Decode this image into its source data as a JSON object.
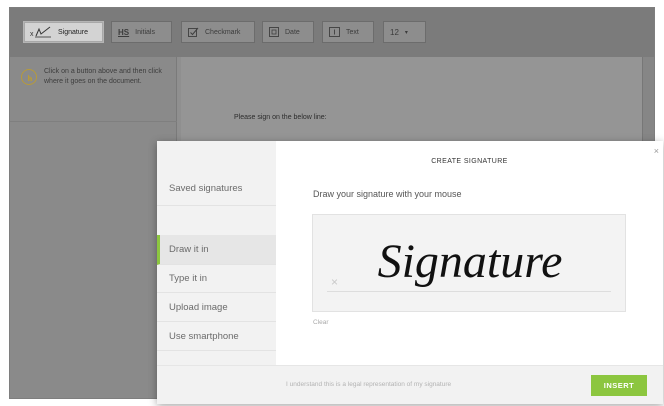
{
  "toolbar": {
    "signature_label": "Signature",
    "initials_badge": "HS",
    "initials_label": "Initials",
    "checkmark_label": "Checkmark",
    "date_label": "Date",
    "text_label": "Text",
    "font_size_value": "12"
  },
  "hint": {
    "text": "Click on a button above and then click where it goes on the document."
  },
  "document": {
    "instruction": "Please sign on the below line:"
  },
  "modal": {
    "title": "CREATE SIGNATURE",
    "close_glyph": "×",
    "subtitle": "Draw your signature with your mouse",
    "nav": {
      "saved": "Saved signatures",
      "draw": "Draw it in",
      "type": "Type it in",
      "upload": "Upload image",
      "smartphone": "Use smartphone"
    },
    "pad": {
      "x_mark": "×",
      "signature_text": "Signature"
    },
    "clear_label": "Clear",
    "footer_text": "I understand this is a legal representation of my signature",
    "insert_label": "INSERT"
  },
  "colors": {
    "accent": "#8cc63f",
    "overlay": "#8f8f8f"
  }
}
